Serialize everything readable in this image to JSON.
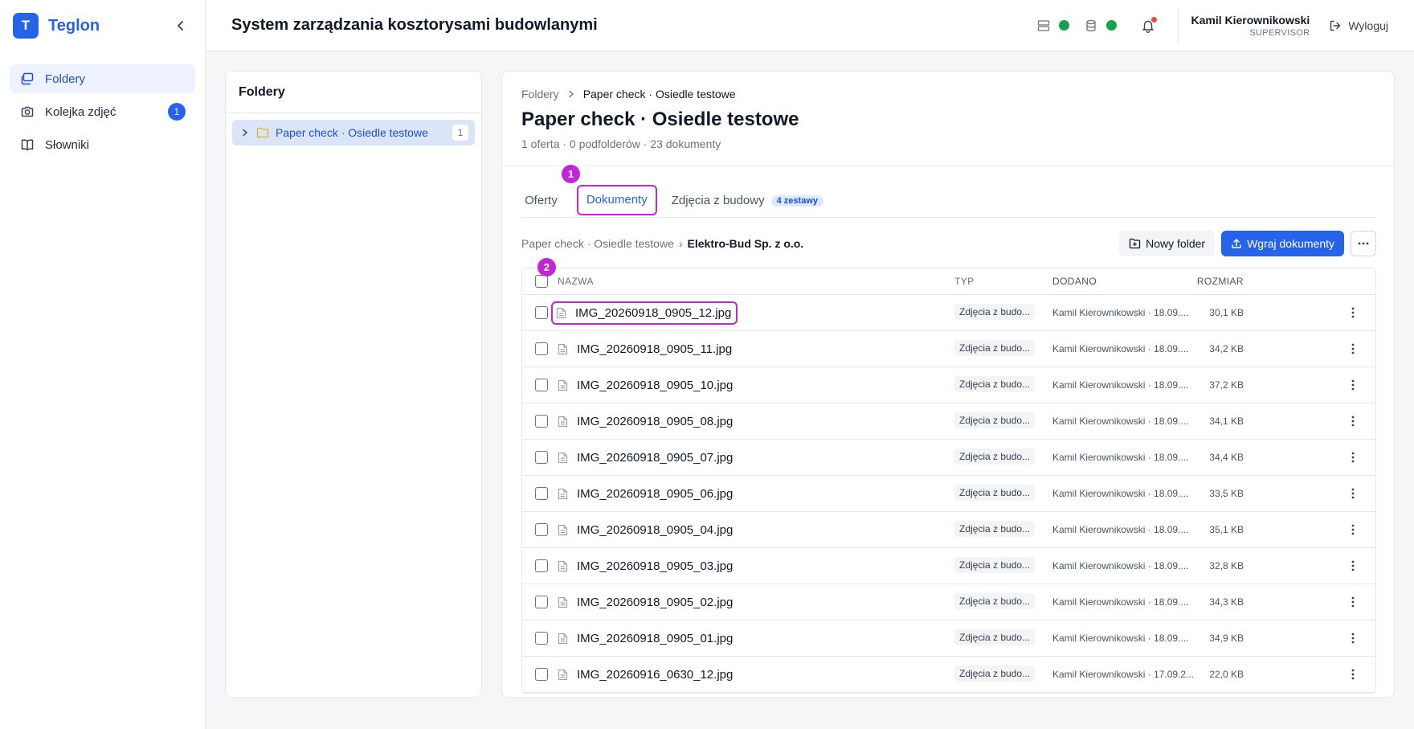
{
  "brand": {
    "logo_letter": "T",
    "name": "Teglon"
  },
  "sidebar": {
    "items": [
      {
        "label": "Foldery",
        "icon": "folders-icon",
        "active": true
      },
      {
        "label": "Kolejka zdjęć",
        "icon": "camera-icon",
        "badge": "1"
      },
      {
        "label": "Słowniki",
        "icon": "book-icon"
      }
    ]
  },
  "header": {
    "title": "System zarządzania kosztorysami budowlanymi",
    "user_name": "Kamil Kierownikowski",
    "user_role": "SUPERVISOR",
    "logout_label": "Wyloguj"
  },
  "folder_panel": {
    "title": "Foldery",
    "tree": [
      {
        "label": "Paper check · Osiedle testowe",
        "count": "1"
      }
    ]
  },
  "main": {
    "breadcrumb": {
      "root": "Foldery",
      "current": "Paper check · Osiedle testowe"
    },
    "title": "Paper check · Osiedle testowe",
    "subtitle": "1 oferta · 0 podfolderów · 23 dokumenty",
    "tabs": [
      {
        "label": "Oferty"
      },
      {
        "label": "Dokumenty",
        "active": true
      },
      {
        "label": "Zdjęcia z budowy",
        "badge": "4 zestawy"
      }
    ],
    "markers": {
      "one": "1",
      "two": "2"
    },
    "path": {
      "root": "Paper check · Osiedle testowe",
      "sep": "›",
      "current": "Elektro-Bud Sp. z o.o."
    },
    "toolbar": {
      "new_folder": "Nowy folder",
      "upload": "Wgraj dokumenty"
    },
    "table": {
      "headers": {
        "name": "NAZWA",
        "type": "TYP",
        "added": "DODANO",
        "size": "ROZMIAR"
      },
      "rows": [
        {
          "name": "IMG_20260918_0905_12.jpg",
          "type": "Zdjęcia z budo...",
          "added": "Kamil Kierownikowski · 18.09....",
          "size": "30,1 KB"
        },
        {
          "name": "IMG_20260918_0905_11.jpg",
          "type": "Zdjęcia z budo...",
          "added": "Kamil Kierownikowski · 18.09....",
          "size": "34,2 KB"
        },
        {
          "name": "IMG_20260918_0905_10.jpg",
          "type": "Zdjęcia z budo...",
          "added": "Kamil Kierownikowski · 18.09....",
          "size": "37,2 KB"
        },
        {
          "name": "IMG_20260918_0905_08.jpg",
          "type": "Zdjęcia z budo...",
          "added": "Kamil Kierownikowski · 18.09....",
          "size": "34,1 KB"
        },
        {
          "name": "IMG_20260918_0905_07.jpg",
          "type": "Zdjęcia z budo...",
          "added": "Kamil Kierownikowski · 18.09....",
          "size": "34,4 KB"
        },
        {
          "name": "IMG_20260918_0905_06.jpg",
          "type": "Zdjęcia z budo...",
          "added": "Kamil Kierownikowski · 18.09....",
          "size": "33,5 KB"
        },
        {
          "name": "IMG_20260918_0905_04.jpg",
          "type": "Zdjęcia z budo...",
          "added": "Kamil Kierownikowski · 18.09....",
          "size": "35,1 KB"
        },
        {
          "name": "IMG_20260918_0905_03.jpg",
          "type": "Zdjęcia z budo...",
          "added": "Kamil Kierownikowski · 18.09....",
          "size": "32,8 KB"
        },
        {
          "name": "IMG_20260918_0905_02.jpg",
          "type": "Zdjęcia z budo...",
          "added": "Kamil Kierownikowski · 18.09....",
          "size": "34,3 KB"
        },
        {
          "name": "IMG_20260918_0905_01.jpg",
          "type": "Zdjęcia z budo...",
          "added": "Kamil Kierownikowski · 18.09....",
          "size": "34,9 KB"
        },
        {
          "name": "IMG_20260916_0630_12.jpg",
          "type": "Zdjęcia z budo...",
          "added": "Kamil Kierownikowski · 17.09.2...",
          "size": "22,0 KB"
        }
      ]
    }
  },
  "colors": {
    "accent": "#2563eb",
    "highlight": "#c026d3",
    "status_ok": "#16a34a",
    "notify": "#ef4444"
  }
}
